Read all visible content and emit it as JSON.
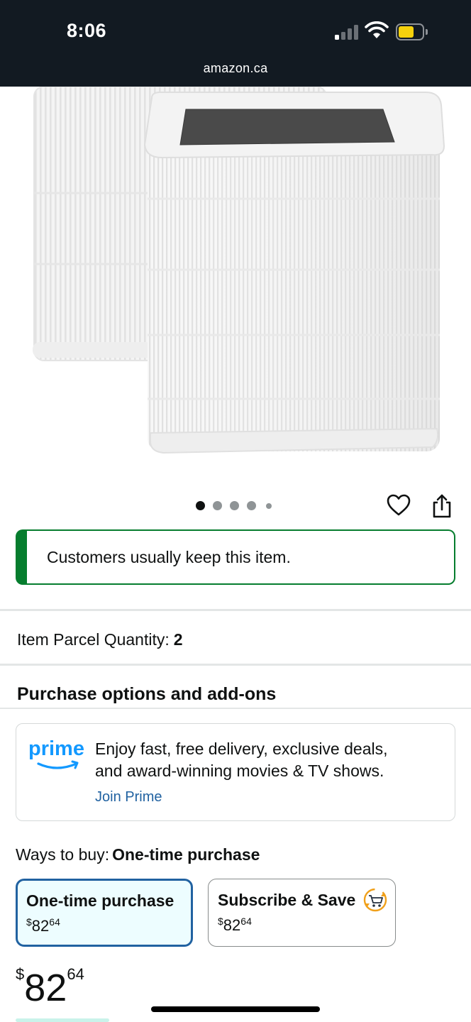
{
  "status_bar": {
    "time": "8:06",
    "signal_icon": "signal-icon",
    "wifi_icon": "wifi-icon",
    "battery_icon": "battery-icon",
    "battery_color": "#f5d10c"
  },
  "browser": {
    "url": "amazon.ca"
  },
  "product": {
    "image_description_icon": "product-image",
    "carousel": {
      "total": 5,
      "current": 1
    },
    "wishlist_icon": "heart-icon",
    "share_icon": "share-icon"
  },
  "keep_banner": {
    "text": "Customers usually keep this item.",
    "accent_color": "#067d2e"
  },
  "parcel": {
    "label": "Item Parcel Quantity:",
    "value": "2"
  },
  "purchase_section": {
    "title": "Purchase options and add-ons"
  },
  "prime": {
    "logo_text": "prime",
    "line1": "Enjoy fast, free delivery, exclusive deals,",
    "line2": "and award-winning movies & TV shows.",
    "link": "Join Prime",
    "brand_color": "#1399ff"
  },
  "ways_to_buy": {
    "label": "Ways to buy:",
    "value": "One-time purchase"
  },
  "options": [
    {
      "title": "One-time purchase",
      "currency": "$",
      "whole": "82",
      "fraction": "64",
      "selected": true
    },
    {
      "title": "Subscribe & Save",
      "currency": "$",
      "whole": "82",
      "fraction": "64",
      "selected": false,
      "icon": "subscribe-cart-icon"
    }
  ],
  "price": {
    "currency": "$",
    "whole": "82",
    "fraction": "64"
  },
  "colors": {
    "link": "#2162a1",
    "selected_border": "#2162a1",
    "selected_bg": "#edfdff",
    "header_bg": "#121a22"
  }
}
